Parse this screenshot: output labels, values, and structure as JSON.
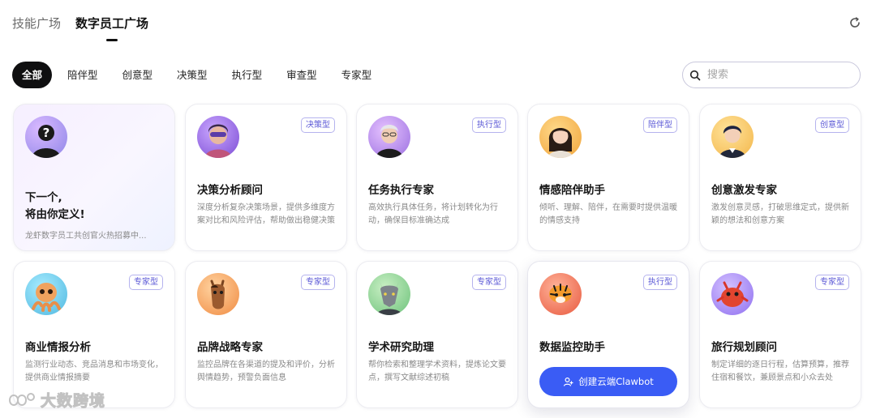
{
  "top_tabs": [
    {
      "label": "技能广场",
      "active": false
    },
    {
      "label": "数字员工广场",
      "active": true
    }
  ],
  "filters": [
    "全部",
    "陪伴型",
    "创意型",
    "决策型",
    "执行型",
    "审查型",
    "专家型"
  ],
  "search": {
    "placeholder": "搜索"
  },
  "featured": {
    "title_line1": "下一个,",
    "title_line2": "将由你定义!",
    "subtitle": "龙虾数字员工共创官火热招募中..."
  },
  "cards": [
    {
      "name": "决策分析顾问",
      "badge": "决策型",
      "desc": "深度分析复杂决策场景，提供多维度方案对比和风险评估，帮助做出稳健决策"
    },
    {
      "name": "任务执行专家",
      "badge": "执行型",
      "desc": "高效执行具体任务，将计划转化为行动，确保目标准确达成"
    },
    {
      "name": "情感陪伴助手",
      "badge": "陪伴型",
      "desc": "倾听、理解、陪伴，在需要时提供温暖的情感支持"
    },
    {
      "name": "创意激发专家",
      "badge": "创意型",
      "desc": "激发创意灵感，打破思维定式，提供新颖的想法和创意方案"
    },
    {
      "name": "商业情报分析",
      "badge": "专家型",
      "desc": "监测行业动态、竞品消息和市场变化，提供商业情报摘要"
    },
    {
      "name": "品牌战略专家",
      "badge": "专家型",
      "desc": "监控品牌在各渠道的提及和评价，分析舆情趋势，预警负面信息"
    },
    {
      "name": "学术研究助理",
      "badge": "专家型",
      "desc": "帮你检索和整理学术资料，提炼论文要点，撰写文献综述初稿"
    },
    {
      "name": "数据监控助手",
      "badge": "执行型",
      "button": "创建云端Clawbot"
    },
    {
      "name": "旅行规划顾问",
      "badge": "专家型",
      "desc": "制定详细的逐日行程，估算预算，推荐住宿和餐饮，兼顾景点和小众去处"
    }
  ],
  "watermark": "大数跨境",
  "colors": {
    "accent": "#3a5cf5",
    "badge_text": "#5a57d6",
    "active_pill": "#0f0f10"
  }
}
